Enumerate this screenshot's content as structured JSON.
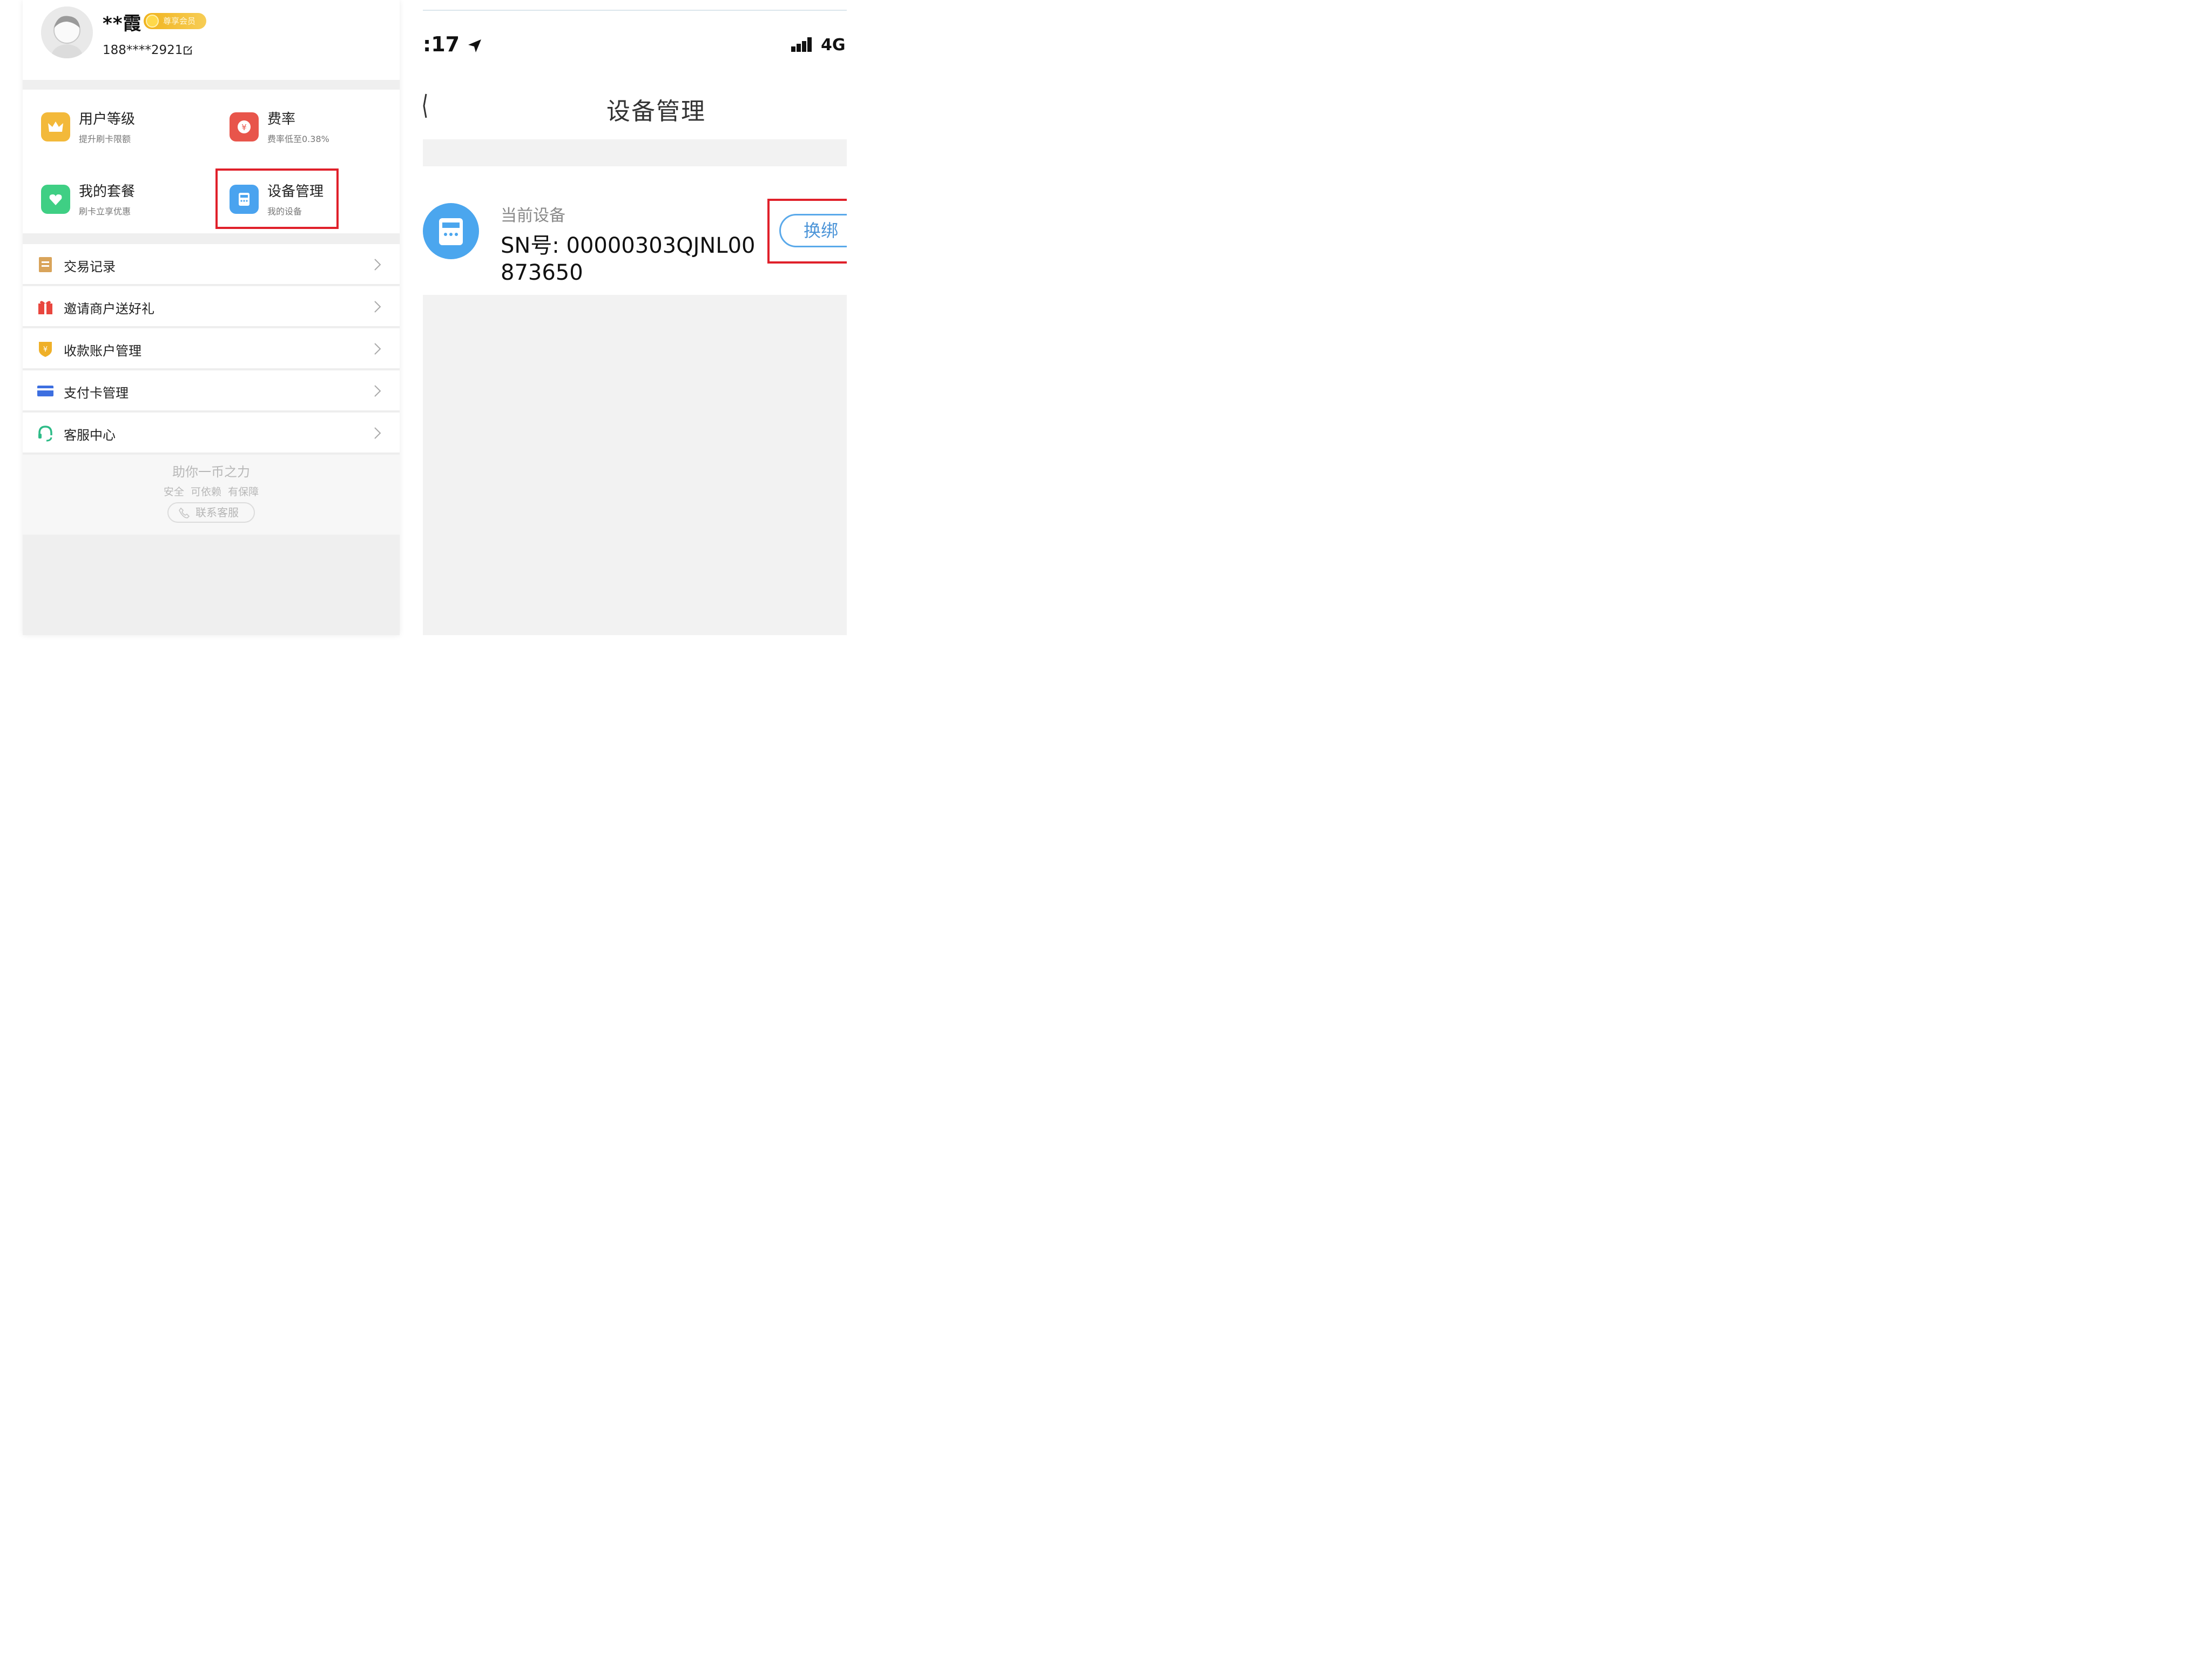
{
  "left": {
    "profile": {
      "name": "**霞",
      "badge": "尊享会员",
      "phone": "188****2921"
    },
    "grid": [
      {
        "title": "用户等级",
        "subtitle": "提升刷卡限额",
        "icon": "crown-icon",
        "color": "#f3b93a"
      },
      {
        "title": "费率",
        "subtitle": "费率低至0.38%",
        "icon": "yuan-icon",
        "color": "#e8554b"
      },
      {
        "title": "我的套餐",
        "subtitle": "刷卡立享优惠",
        "icon": "heart-icon",
        "color": "#3fcf84"
      },
      {
        "title": "设备管理",
        "subtitle": "我的设备",
        "icon": "pos-device-icon",
        "color": "#4aa3ef"
      }
    ],
    "list": [
      {
        "label": "交易记录",
        "icon": "record-icon",
        "color": "#d9a45a"
      },
      {
        "label": "邀请商户送好礼",
        "icon": "gift-icon",
        "color": "#e9463e"
      },
      {
        "label": "收款账户管理",
        "icon": "shield-yuan-icon",
        "color": "#efb028"
      },
      {
        "label": "支付卡管理",
        "icon": "card-icon",
        "color": "#3d6fe0"
      },
      {
        "label": "客服中心",
        "icon": "headset-icon",
        "color": "#2dbb87"
      }
    ],
    "footer": {
      "slogan": "助你一币之力",
      "subslogan": "安全  可依赖  有保障",
      "contact": "联系客服"
    }
  },
  "right": {
    "status": {
      "time": ":17",
      "network": "4G"
    },
    "nav_title": "设备管理",
    "device": {
      "label": "当前设备",
      "sn_line1": "SN号: 00000303QJNL00",
      "sn_line2": "873650",
      "rebind": "换绑"
    }
  },
  "colors": {
    "highlight": "#e0202a",
    "accent_blue": "#4aa3ef"
  }
}
